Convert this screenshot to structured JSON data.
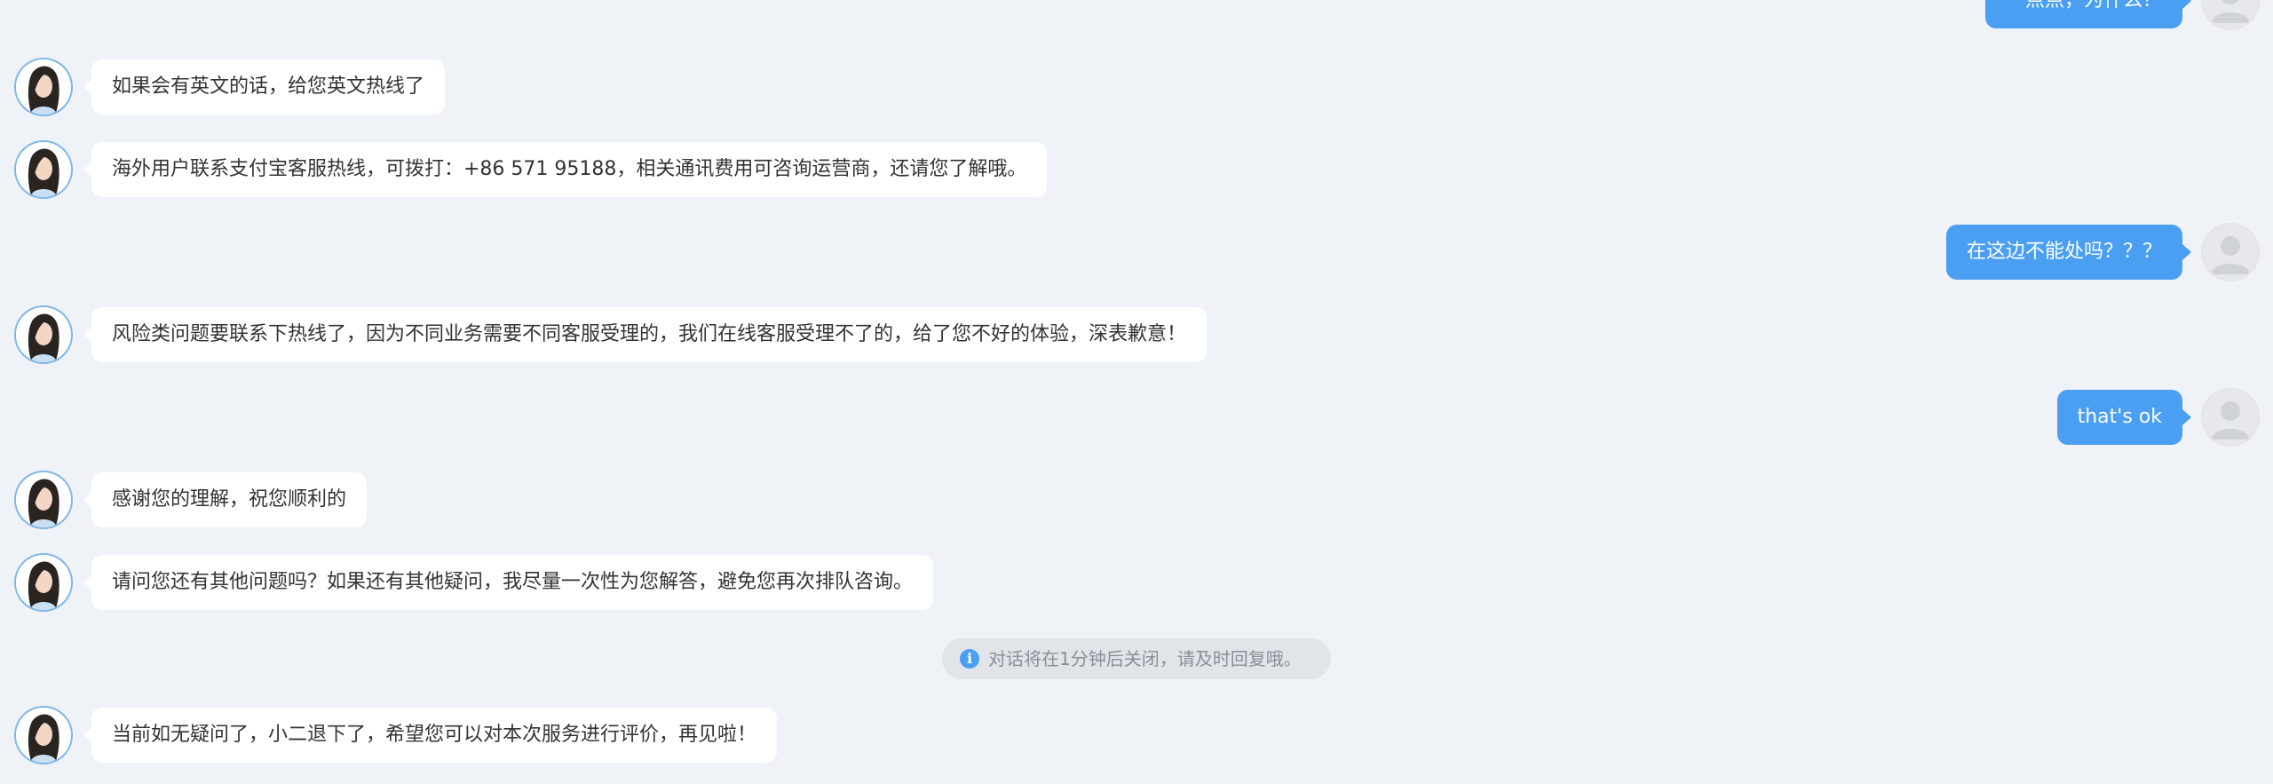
{
  "colors": {
    "background": "#eff2f6",
    "user_bubble": "#4a9ff3",
    "agent_bubble": "#ffffff",
    "agent_text": "#333333",
    "notice_text": "#8a8f96"
  },
  "messages": [
    {
      "sender": "user",
      "text": "一点点，为什么？"
    },
    {
      "sender": "agent",
      "text": "如果会有英文的话，给您英文热线了"
    },
    {
      "sender": "agent",
      "text": "海外用户联系支付宝客服热线，可拨打：+86 571 95188，相关通讯费用可咨询运营商，还请您了解哦。"
    },
    {
      "sender": "user",
      "text": "在这边不能处吗？？？"
    },
    {
      "sender": "agent",
      "text": "风险类问题要联系下热线了，因为不同业务需要不同客服受理的，我们在线客服受理不了的，给了您不好的体验，深表歉意！"
    },
    {
      "sender": "user",
      "text": "that's ok"
    },
    {
      "sender": "agent",
      "text": "感谢您的理解，祝您顺利的"
    },
    {
      "sender": "agent",
      "text": "请问您还有其他问题吗？如果还有其他疑问，我尽量一次性为您解答，避免您再次排队咨询。"
    },
    {
      "sender": "agent",
      "text": "当前如无疑问了，小二退下了，希望您可以对本次服务进行评价，再见啦！"
    }
  ],
  "system_notice": {
    "icon": "info-icon",
    "icon_glyph": "i",
    "text": "对话将在1分钟后关闭，请及时回复哦。"
  },
  "avatars": {
    "agent": "agent-avatar-icon",
    "user": "user-avatar-icon"
  }
}
